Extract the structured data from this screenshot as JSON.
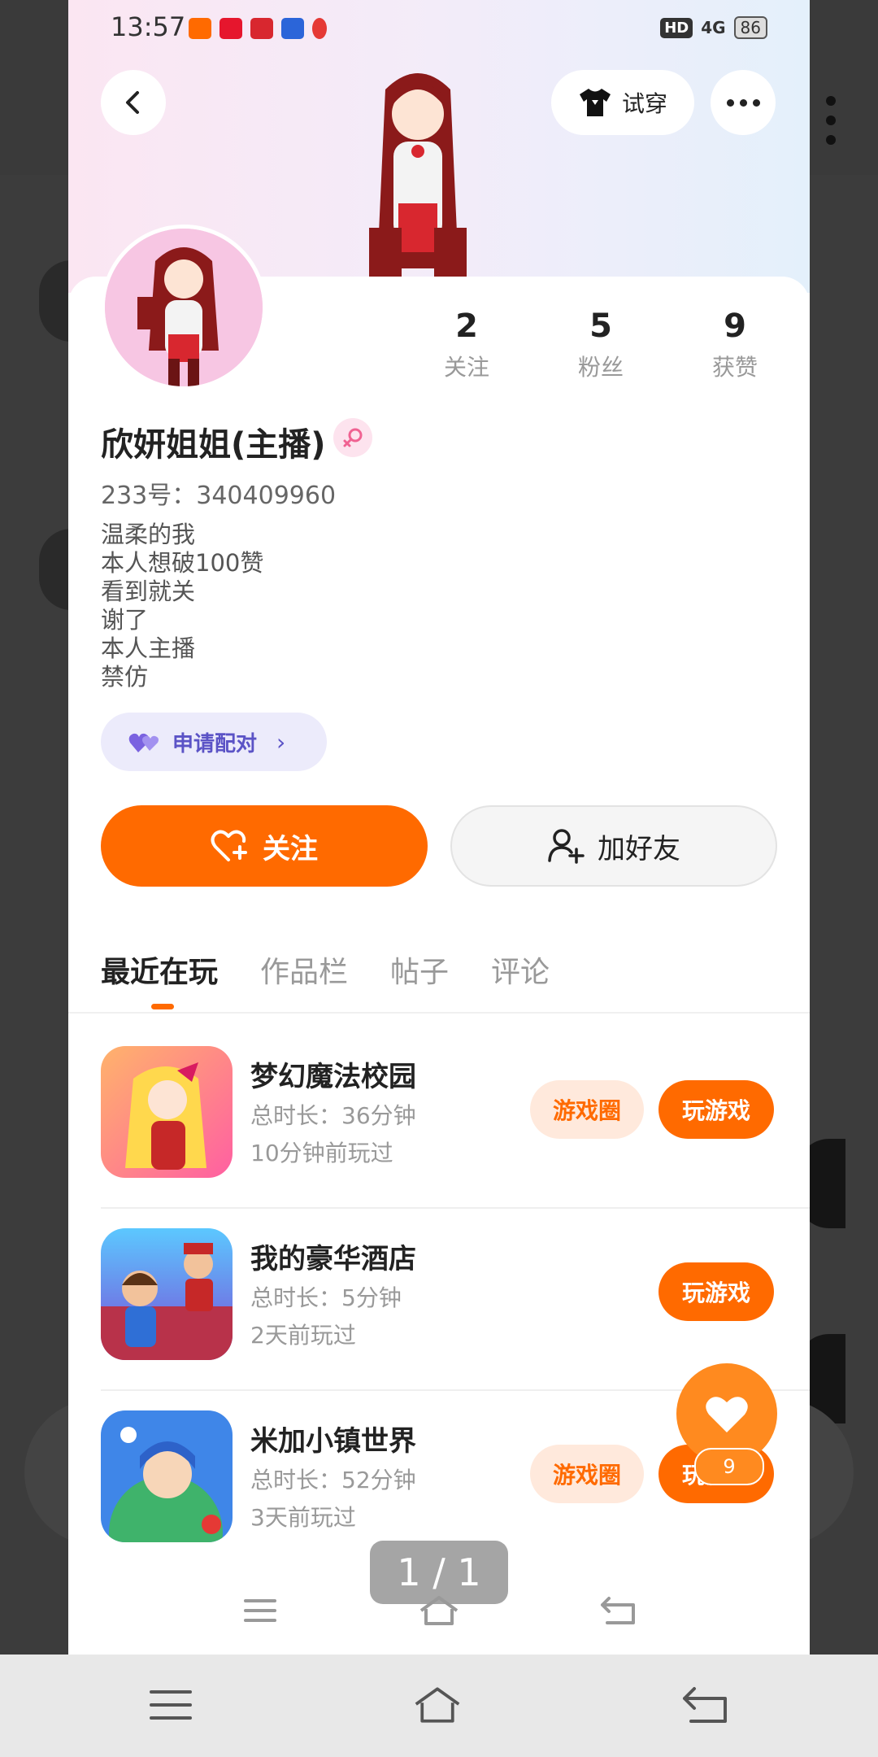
{
  "status_bar": {
    "time": "13:57",
    "network": "4G",
    "battery": "86",
    "hd": "HD"
  },
  "header": {
    "try_on_label": "试穿"
  },
  "profile": {
    "stats": [
      {
        "value": "2",
        "label": "关注"
      },
      {
        "value": "5",
        "label": "粉丝"
      },
      {
        "value": "9",
        "label": "获赞"
      }
    ],
    "nickname": "欣妍姐姐(主播)",
    "uid": "233号：340409960",
    "bio": [
      "温柔的我",
      "本人想破100赞",
      "看到就关",
      "谢了",
      "本人主播",
      "禁仿"
    ],
    "pair_label": "申请配对",
    "follow_label": "关注",
    "add_friend_label": "加好友"
  },
  "tabs": [
    "最近在玩",
    "作品栏",
    "帖子",
    "评论"
  ],
  "games": [
    {
      "name": "梦幻魔法校园",
      "duration": "总时长：36分钟",
      "last_played": "10分钟前玩过",
      "circle_label": "游戏圈",
      "play_label": "玩游戏"
    },
    {
      "name": "我的豪华酒店",
      "duration": "总时长：5分钟",
      "last_played": "2天前玩过",
      "play_label": "玩游戏"
    },
    {
      "name": "米加小镇世界",
      "duration": "总时长：52分钟",
      "last_played": "3天前玩过",
      "circle_label": "游戏圈",
      "play_label": "玩游戏"
    }
  ],
  "like_count": "9",
  "viewer": {
    "page_indicator": "1 / 1"
  },
  "colors": {
    "accent": "#ff6a00",
    "pair": "#5b53c6"
  }
}
